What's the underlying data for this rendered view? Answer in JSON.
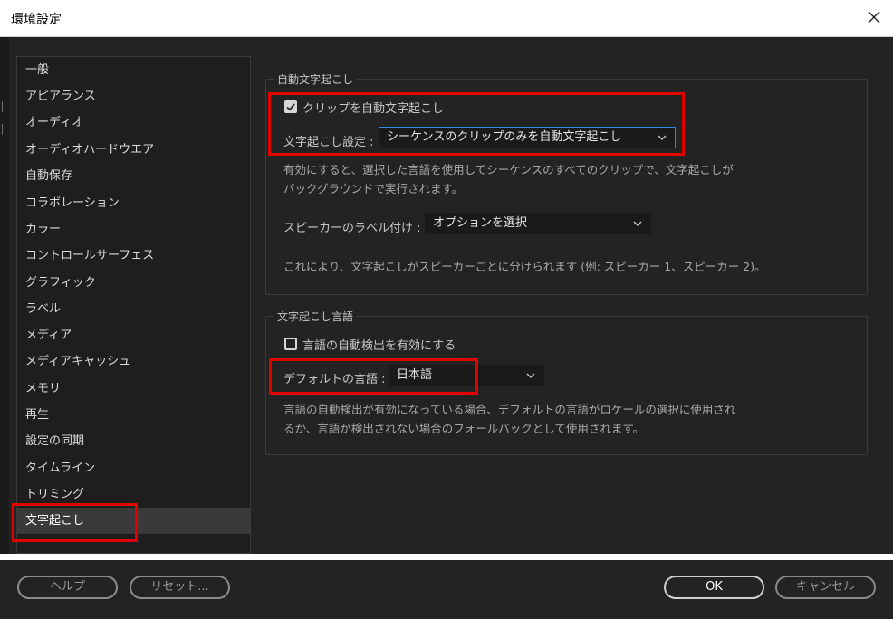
{
  "window": {
    "title": "環境設定"
  },
  "sidebar": {
    "items": [
      {
        "label": "一般"
      },
      {
        "label": "アピアランス"
      },
      {
        "label": "オーディオ"
      },
      {
        "label": "オーディオハードウエア"
      },
      {
        "label": "自動保存"
      },
      {
        "label": "コラボレーション"
      },
      {
        "label": "カラー"
      },
      {
        "label": "コントロールサーフェス"
      },
      {
        "label": "グラフィック"
      },
      {
        "label": "ラベル"
      },
      {
        "label": "メディア"
      },
      {
        "label": "メディアキャッシュ"
      },
      {
        "label": "メモリ"
      },
      {
        "label": "再生"
      },
      {
        "label": "設定の同期"
      },
      {
        "label": "タイムライン"
      },
      {
        "label": "トリミング"
      },
      {
        "label": "文字起こし"
      }
    ],
    "selected": "文字起こし"
  },
  "auto_transcribe": {
    "section_title": "自動文字起こし",
    "checkbox_label": "クリップを自動文字起こし",
    "checked": true,
    "setting_label": "文字起こし設定 :",
    "setting_value": "シーケンスのクリップのみを自動文字起こし",
    "description_line1": "有効にすると、選択した言語を使用してシーケンスのすべてのクリップで、文字起こしが",
    "description_line2": "バックグラウンドで実行されます。",
    "speaker_label": "スピーカーのラベル付け :",
    "speaker_value": "オプションを選択",
    "speaker_description": "これにより、文字起こしがスピーカーごとに分けられます (例: スピーカー 1、スピーカー 2)。"
  },
  "transcribe_language": {
    "section_title": "文字起こし言語",
    "checkbox_label": "言語の自動検出を有効にする",
    "checked": false,
    "default_label": "デフォルトの言語 :",
    "default_value": "日本語",
    "description_line1": "言語の自動検出が有効になっている場合、デフォルトの言語がロケールの選択に使用され",
    "description_line2": "るか、言語が検出されない場合のフォールバックとして使用されます。"
  },
  "footer": {
    "help": "ヘルプ",
    "reset": "リセット...",
    "ok": "OK",
    "cancel": "キャンセル"
  },
  "colors": {
    "background": "#232323",
    "highlight": "#e00000",
    "focus": "#2d8ceb"
  }
}
